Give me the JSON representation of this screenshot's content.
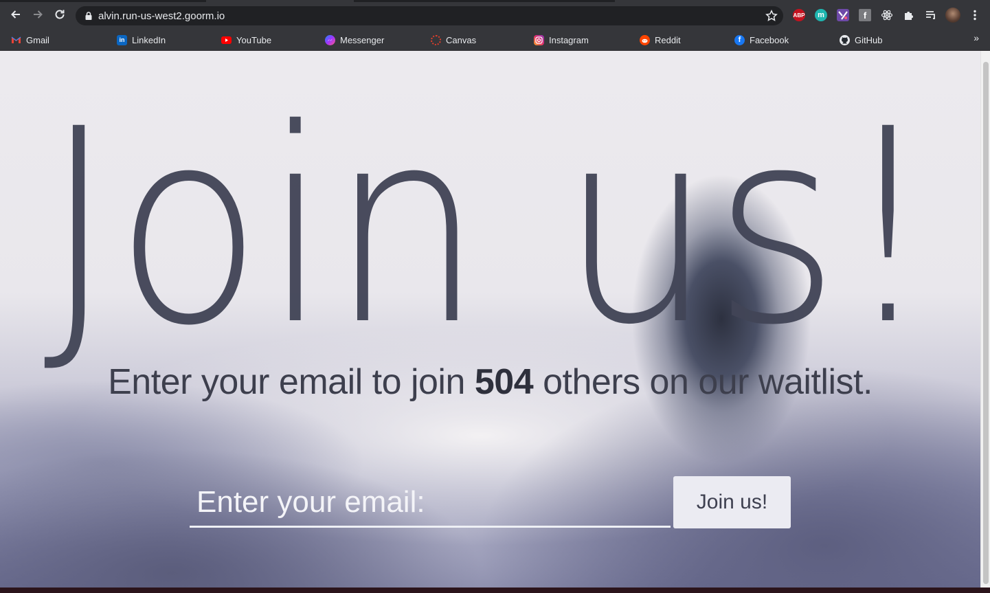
{
  "browser": {
    "url": "alvin.run-us-west2.goorm.io",
    "bookmarks": [
      {
        "label": "Gmail",
        "icon": "gmail-icon"
      },
      {
        "label": "LinkedIn",
        "icon": "linkedin-icon"
      },
      {
        "label": "YouTube",
        "icon": "youtube-icon"
      },
      {
        "label": "Messenger",
        "icon": "messenger-icon"
      },
      {
        "label": "Canvas",
        "icon": "canvas-icon"
      },
      {
        "label": "Instagram",
        "icon": "instagram-icon"
      },
      {
        "label": "Reddit",
        "icon": "reddit-icon"
      },
      {
        "label": "Facebook",
        "icon": "facebook-icon"
      },
      {
        "label": "GitHub",
        "icon": "github-icon"
      }
    ],
    "more_bookmarks": "»",
    "extensions": [
      {
        "name": "adblock-plus-icon",
        "text": "ABP"
      },
      {
        "name": "m-extension-icon",
        "text": "m"
      },
      {
        "name": "yahtzee-extension-icon",
        "text": ""
      },
      {
        "name": "f-extension-icon",
        "text": "f"
      },
      {
        "name": "react-devtools-icon",
        "text": ""
      },
      {
        "name": "puzzle-extensions-icon",
        "text": ""
      },
      {
        "name": "reading-list-icon",
        "text": ""
      },
      {
        "name": "profile-avatar-icon",
        "text": ""
      }
    ]
  },
  "page": {
    "headline": "Join us!",
    "subtitle_prefix": "Enter your email to join ",
    "subtitle_count": "504",
    "subtitle_suffix": " others on our waitlist.",
    "email_placeholder": "Enter your email:",
    "join_button_label": "Join us!"
  },
  "colors": {
    "headline": "#424556",
    "chrome": "#35363a",
    "omnibox": "#202124"
  }
}
